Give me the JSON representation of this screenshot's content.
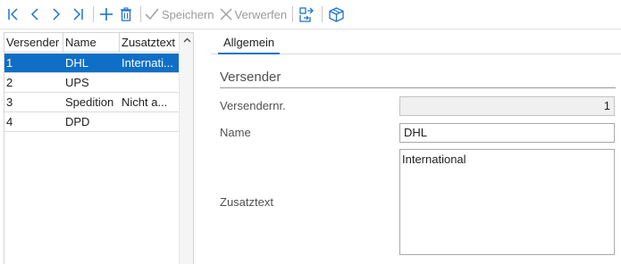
{
  "toolbar": {
    "first_icon": "first-record-icon",
    "prev_icon": "previous-record-icon",
    "next_icon": "next-record-icon",
    "last_icon": "last-record-icon",
    "add_icon": "add-icon",
    "delete_icon": "delete-icon",
    "save_label": "Speichern",
    "discard_label": "Verwerfen",
    "export_icon": "export-icon",
    "package_icon": "package-icon"
  },
  "grid": {
    "columns": [
      "Versender",
      "Name",
      "Zusatztext"
    ],
    "rows": [
      {
        "nr": "1",
        "name": "DHL",
        "extra": "Internati..."
      },
      {
        "nr": "2",
        "name": "UPS",
        "extra": ""
      },
      {
        "nr": "3",
        "name": "Spedition",
        "extra": "Nicht a..."
      },
      {
        "nr": "4",
        "name": "DPD",
        "extra": ""
      }
    ],
    "selected_index": 0
  },
  "detail": {
    "tab": "Allgemein",
    "section": "Versender",
    "fields": {
      "nr_label": "Versendernr.",
      "nr_value": "1",
      "name_label": "Name",
      "name_value": "DHL",
      "extra_label": "Zusatztext",
      "extra_value": "International"
    }
  },
  "colors": {
    "accent": "#1e73c9",
    "selection": "#0f6fc6",
    "disabled": "#a0a0a0"
  }
}
